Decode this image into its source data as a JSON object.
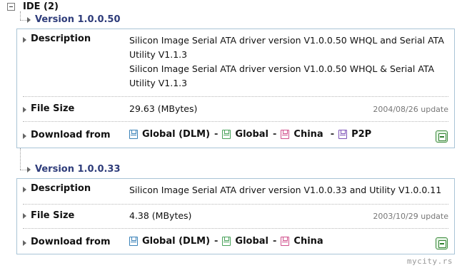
{
  "category": {
    "title": "IDE (2)"
  },
  "versions": [
    {
      "name": "Version 1.0.0.50",
      "description_label": "Description",
      "description_lines": [
        "Silicon Image Serial ATA driver version V1.0.0.50 WHQL and Serial ATA",
        "Utility V1.1.3",
        "Silicon Image Serial ATA driver version V1.0.0.50 WHQL & Serial ATA",
        "Utility V1.1.3"
      ],
      "filesize_label": "File Size",
      "filesize": "29.63 (MBytes)",
      "update": "2004/08/26 update",
      "download_label": "Download from",
      "links": [
        "Global (DLM)",
        "Global",
        "China",
        "P2P"
      ]
    },
    {
      "name": "Version 1.0.0.33",
      "description_label": "Description",
      "description_lines": [
        "Silicon Image Serial ATA driver version V1.0.0.33 and Utility V1.0.0.11"
      ],
      "filesize_label": "File Size",
      "filesize": "4.38 (MBytes)",
      "update": "2003/10/29 update",
      "download_label": "Download from",
      "links": [
        "Global (DLM)",
        "Global",
        "China"
      ]
    }
  ],
  "link_separator": "-",
  "icons": {
    "collapse": "minus-box-icon",
    "expand": "triangle-right-icon",
    "floppy": "floppy-disk-icon",
    "side": "green-floppy-icon"
  },
  "colors": {
    "version_title": "#2e3c7a",
    "box_border": "#a9c4d6",
    "floppy_blue": "#3a82b8",
    "floppy_green": "#49a25a",
    "floppy_pink": "#d0508c",
    "floppy_purple": "#7d52b8"
  },
  "watermark": "mycity.rs"
}
